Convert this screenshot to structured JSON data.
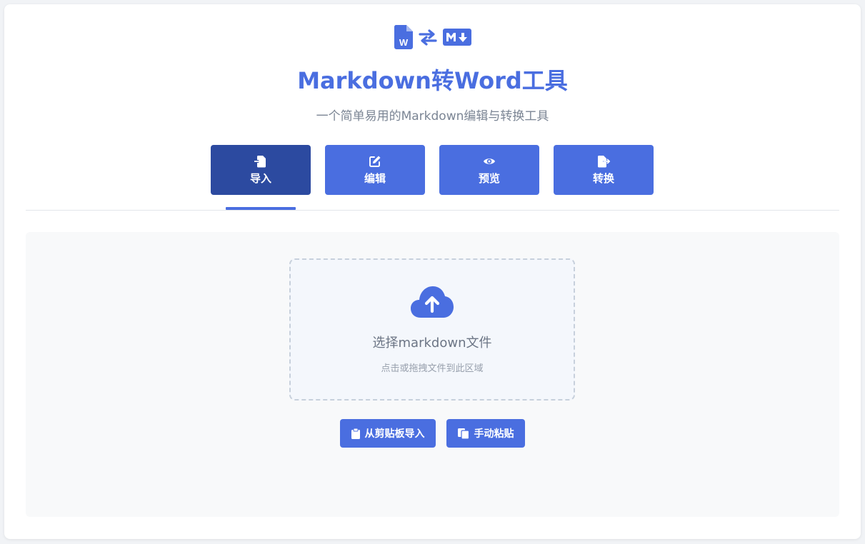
{
  "header": {
    "title": "Markdown转Word工具",
    "subtitle": "一个简单易用的Markdown编辑与转换工具",
    "logo_icons": [
      "word-file-icon",
      "swap-arrows-icon",
      "markdown-icon"
    ]
  },
  "tabs": [
    {
      "label": "导入",
      "icon": "file-import-icon",
      "active": true
    },
    {
      "label": "编辑",
      "icon": "edit-icon",
      "active": false
    },
    {
      "label": "预览",
      "icon": "eye-icon",
      "active": false
    },
    {
      "label": "转换",
      "icon": "file-export-icon",
      "active": false
    }
  ],
  "import": {
    "dropzone_title": "选择markdown文件",
    "dropzone_hint": "点击或拖拽文件到此区域",
    "clipboard_button": "从剪贴板导入",
    "paste_button": "手动粘贴"
  },
  "colors": {
    "accent": "#4a6ee0",
    "active_tab": "#2c4aa0",
    "subtitle_text": "#7b8594"
  }
}
